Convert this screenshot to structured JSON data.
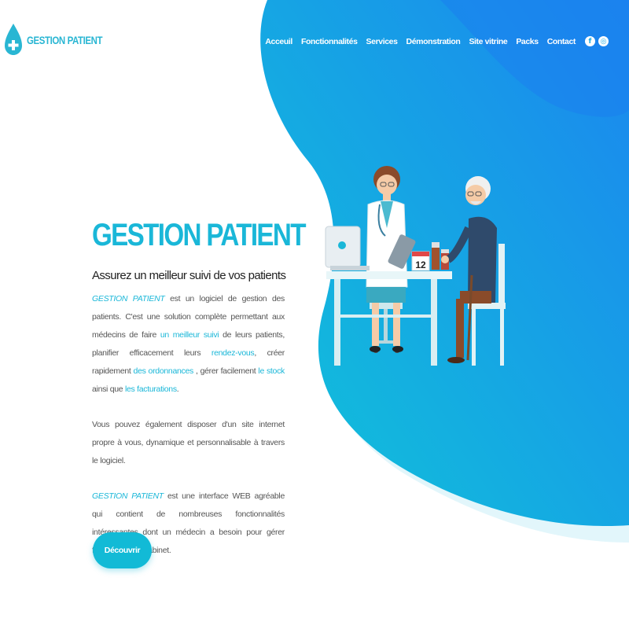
{
  "brand": {
    "name": "GESTION PATIENT"
  },
  "nav": {
    "items": [
      "Acceuil",
      "Fonctionnalités",
      "Services",
      "Démonstration",
      "Site vitrine",
      "Packs",
      "Contact"
    ]
  },
  "social": {
    "facebook_glyph": "f",
    "instagram_glyph": "◎"
  },
  "hero": {
    "title": "GESTION PATIENT",
    "subtitle": "Assurez un meilleur suivi de vos patients",
    "p1": {
      "s1": "GESTION PATIENT",
      "s2": " est un logiciel de gestion des patients. C'est une solution complète permettant aux médecins de faire ",
      "s3": "un meilleur suivi",
      "s4": " de leurs patients, planifier efficacement leurs ",
      "s5": "rendez-vous",
      "s6": ", créer rapidement ",
      "s7": "des ordonnances",
      "s8": " , gérer facilement ",
      "s9": "le stock",
      "s10": " ainsi que ",
      "s11": "les facturations",
      "s12": "."
    },
    "p2": "Vous pouvez également disposer d'un site internet propre à vous, dynamique et personnalisable à travers le logiciel.",
    "p3": {
      "s1": "GESTION PATIENT",
      "s2": " est une interface WEB agréable qui contient de nombreuses fonctionnalités intéressantes dont un médecin a besoin pour gérer facilement son cabinet."
    },
    "button": "Découvrir",
    "calendar_day": "12"
  },
  "colors": {
    "accent": "#1ab7d8",
    "gradient_start": "#12c3db",
    "gradient_end": "#1a8cf0"
  },
  "icons": {
    "logo": "drop-cross-icon",
    "facebook": "facebook-icon",
    "instagram": "instagram-icon"
  }
}
